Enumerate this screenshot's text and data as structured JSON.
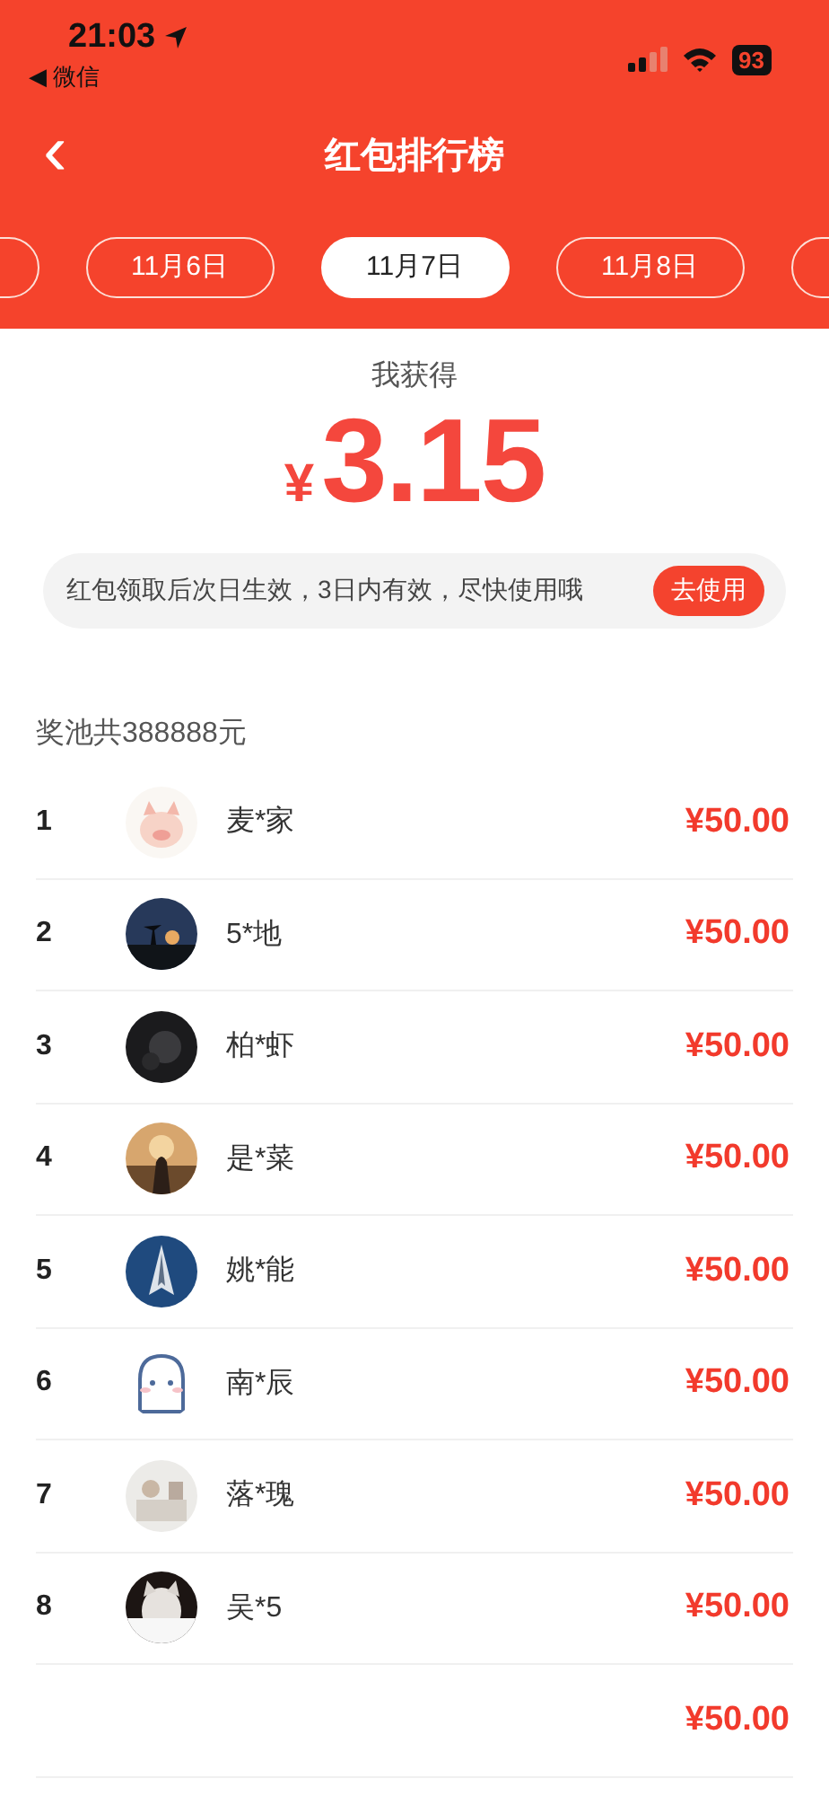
{
  "status_bar": {
    "time": "21:03",
    "back_app": "◀ 微信",
    "battery": "93"
  },
  "nav": {
    "back": "‹",
    "title": "红包排行榜"
  },
  "tabs": [
    {
      "selected": false
    },
    {
      "label": "11月6日",
      "selected": false
    },
    {
      "label": "11月7日",
      "selected": true
    },
    {
      "label": "11月8日",
      "selected": false
    },
    {
      "selected": false
    }
  ],
  "earned": {
    "label": "我获得",
    "currency": "¥",
    "amount": "3.15"
  },
  "notice": {
    "text": "红包领取后次日生效，3日内有效，尽快使用哦",
    "button": "去使用"
  },
  "pool": "奖池共388888元",
  "rows": [
    {
      "rank": "1",
      "name": "麦*家",
      "amount": "¥50.00"
    },
    {
      "rank": "2",
      "name": "5*地",
      "amount": "¥50.00"
    },
    {
      "rank": "3",
      "name": "柏*虾",
      "amount": "¥50.00"
    },
    {
      "rank": "4",
      "name": "是*菜",
      "amount": "¥50.00"
    },
    {
      "rank": "5",
      "name": "姚*能",
      "amount": "¥50.00"
    },
    {
      "rank": "6",
      "name": "南*辰",
      "amount": "¥50.00"
    },
    {
      "rank": "7",
      "name": "落*瑰",
      "amount": "¥50.00"
    },
    {
      "rank": "8",
      "name": "吴*5",
      "amount": "¥50.00"
    },
    {
      "amount": "¥50.00"
    }
  ]
}
